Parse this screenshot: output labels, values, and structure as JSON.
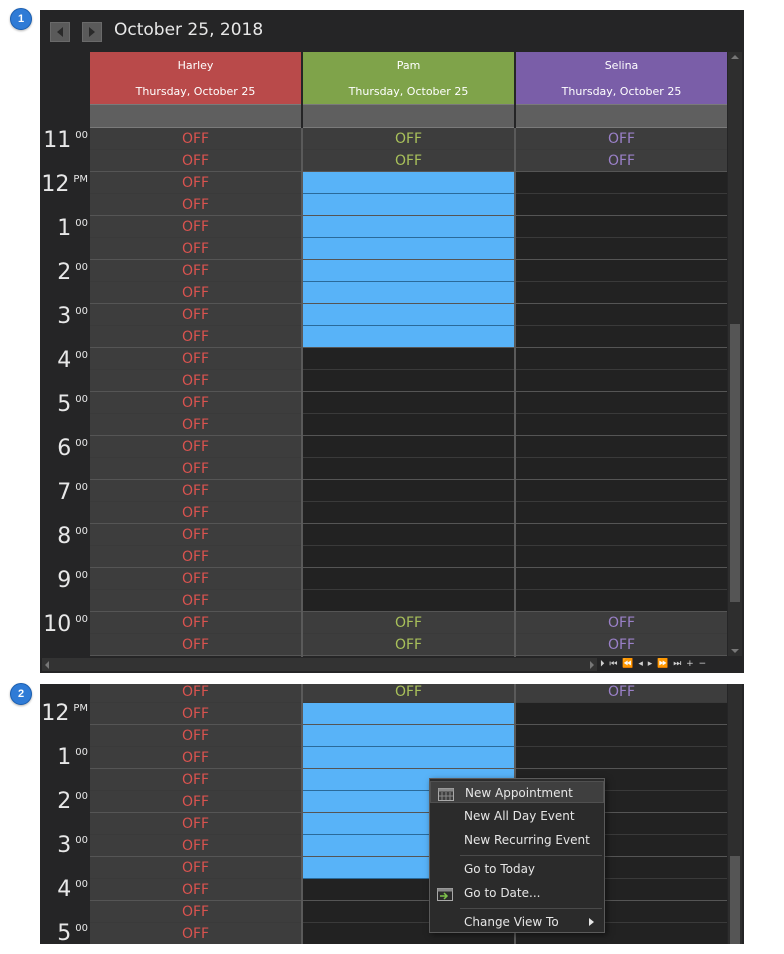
{
  "badges": [
    "1",
    "2"
  ],
  "header": {
    "date_title": "October 25, 2018",
    "prev_icon": "chevron-left-icon",
    "next_icon": "chevron-right-icon"
  },
  "resources": [
    {
      "name": "Harley",
      "date": "Thursday, October 25",
      "color": "#b94a4a",
      "off_text_color": "#d9534f"
    },
    {
      "name": "Pam",
      "date": "Thursday, October 25",
      "color": "#7fa34a",
      "off_text_color": "#a8c05a"
    },
    {
      "name": "Selina",
      "date": "Thursday, October 25",
      "color": "#7a5ea8",
      "off_text_color": "#9a80c8"
    }
  ],
  "slot_text": "OFF",
  "view1": {
    "hours": [
      {
        "h": "11",
        "m": "00"
      },
      {
        "h": "12",
        "m": "PM"
      },
      {
        "h": "1",
        "m": "00"
      },
      {
        "h": "2",
        "m": "00"
      },
      {
        "h": "3",
        "m": "00"
      },
      {
        "h": "4",
        "m": "00"
      },
      {
        "h": "5",
        "m": "00"
      },
      {
        "h": "6",
        "m": "00"
      },
      {
        "h": "7",
        "m": "00"
      },
      {
        "h": "8",
        "m": "00"
      },
      {
        "h": "9",
        "m": "00"
      },
      {
        "h": "10",
        "m": "00"
      }
    ],
    "cols": [
      "OOOOOOOOOOOOOOOOOOOOOOOO",
      "OOBBBBBBBBFFFFFFFFFFFFOO",
      "OOFFFFFFFFFFFFFFFFFFFFOO"
    ]
  },
  "view2": {
    "hours": [
      {
        "h": "12",
        "m": "PM"
      },
      {
        "h": "1",
        "m": "00"
      },
      {
        "h": "2",
        "m": "00"
      },
      {
        "h": "3",
        "m": "00"
      },
      {
        "h": "4",
        "m": "00"
      },
      {
        "h": "5",
        "m": "00"
      }
    ],
    "cols": [
      "OOOOOOOOOOOO",
      "OBBBBBBBBFFF",
      "OFFFFFFFFFFF"
    ]
  },
  "pager_glyphs": "⏵ ⏮ ⏪ ◂ ▸ ⏩ ⏭ + −",
  "context_menu": [
    {
      "label": "New Appointment",
      "icon": "calendar-grid-icon",
      "highlight": true
    },
    {
      "label": "New All Day Event"
    },
    {
      "label": "New Recurring Event"
    },
    {
      "label": "Go to Today",
      "sep_before": true
    },
    {
      "label": "Go to Date...",
      "icon": "goto-date-icon"
    },
    {
      "label": "Change View To",
      "sep_before": true,
      "submenu": true
    }
  ]
}
